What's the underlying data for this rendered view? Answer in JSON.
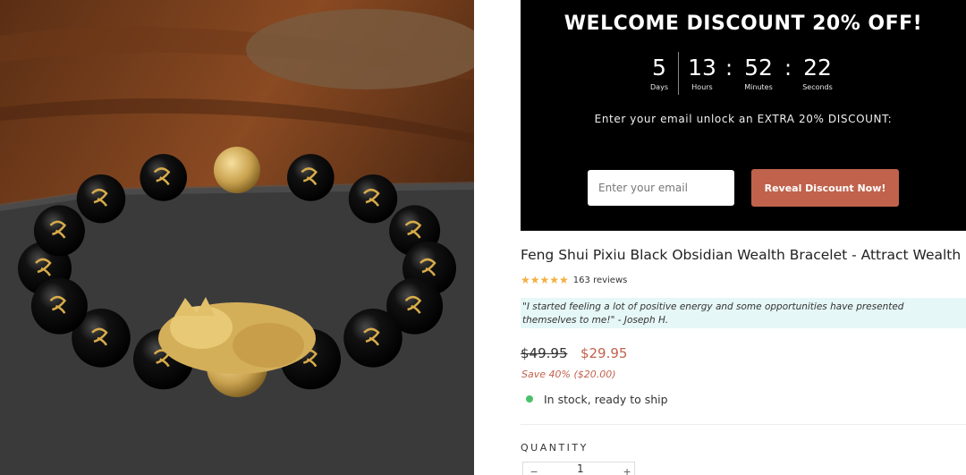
{
  "product_image": {
    "icon": "pixiu-bracelet-photo"
  },
  "banner": {
    "title": "WELCOME DISCOUNT 20% OFF!",
    "countdown": {
      "days": "5",
      "days_label": "Days",
      "hours": "13",
      "hours_label": "Hours",
      "minutes": "52",
      "minutes_label": "Minutes",
      "seconds": "22",
      "seconds_label": "Seconds",
      "separator": ":"
    },
    "subtitle": "Enter your email unlock an EXTRA 20% DISCOUNT:",
    "email_placeholder": "Enter your email",
    "button_label": "Reveal Discount Now!",
    "button_color": "#c0624c"
  },
  "product": {
    "title": "Feng Shui Pixiu Black Obsidian Wealth Bracelet - Attract Wealth",
    "stars": "★★★★★",
    "rating": 5,
    "reviews": "163 reviews",
    "testimonial_line1": "\"I started feeling a lot of positive energy and some opportunities have presented",
    "testimonial_line2": "themselves to me!\" - Joseph H.",
    "old_price": "$49.95",
    "new_price": "$29.95",
    "savings": "Save 40% ($20.00)",
    "stock": "In stock, ready to ship",
    "stock_color": "#4bc26a",
    "quantity_label": "QUANTITY",
    "quantity_value": "1",
    "minus_symbol": "−",
    "plus_symbol": "+"
  }
}
